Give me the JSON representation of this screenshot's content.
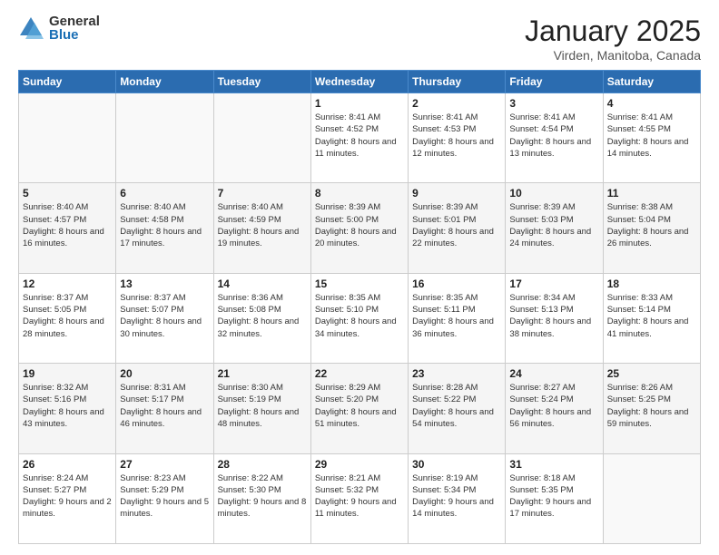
{
  "logo": {
    "general": "General",
    "blue": "Blue"
  },
  "header": {
    "title": "January 2025",
    "subtitle": "Virden, Manitoba, Canada"
  },
  "weekdays": [
    "Sunday",
    "Monday",
    "Tuesday",
    "Wednesday",
    "Thursday",
    "Friday",
    "Saturday"
  ],
  "weeks": [
    [
      {
        "day": "",
        "info": ""
      },
      {
        "day": "",
        "info": ""
      },
      {
        "day": "",
        "info": ""
      },
      {
        "day": "1",
        "info": "Sunrise: 8:41 AM\nSunset: 4:52 PM\nDaylight: 8 hours\nand 11 minutes."
      },
      {
        "day": "2",
        "info": "Sunrise: 8:41 AM\nSunset: 4:53 PM\nDaylight: 8 hours\nand 12 minutes."
      },
      {
        "day": "3",
        "info": "Sunrise: 8:41 AM\nSunset: 4:54 PM\nDaylight: 8 hours\nand 13 minutes."
      },
      {
        "day": "4",
        "info": "Sunrise: 8:41 AM\nSunset: 4:55 PM\nDaylight: 8 hours\nand 14 minutes."
      }
    ],
    [
      {
        "day": "5",
        "info": "Sunrise: 8:40 AM\nSunset: 4:57 PM\nDaylight: 8 hours\nand 16 minutes."
      },
      {
        "day": "6",
        "info": "Sunrise: 8:40 AM\nSunset: 4:58 PM\nDaylight: 8 hours\nand 17 minutes."
      },
      {
        "day": "7",
        "info": "Sunrise: 8:40 AM\nSunset: 4:59 PM\nDaylight: 8 hours\nand 19 minutes."
      },
      {
        "day": "8",
        "info": "Sunrise: 8:39 AM\nSunset: 5:00 PM\nDaylight: 8 hours\nand 20 minutes."
      },
      {
        "day": "9",
        "info": "Sunrise: 8:39 AM\nSunset: 5:01 PM\nDaylight: 8 hours\nand 22 minutes."
      },
      {
        "day": "10",
        "info": "Sunrise: 8:39 AM\nSunset: 5:03 PM\nDaylight: 8 hours\nand 24 minutes."
      },
      {
        "day": "11",
        "info": "Sunrise: 8:38 AM\nSunset: 5:04 PM\nDaylight: 8 hours\nand 26 minutes."
      }
    ],
    [
      {
        "day": "12",
        "info": "Sunrise: 8:37 AM\nSunset: 5:05 PM\nDaylight: 8 hours\nand 28 minutes."
      },
      {
        "day": "13",
        "info": "Sunrise: 8:37 AM\nSunset: 5:07 PM\nDaylight: 8 hours\nand 30 minutes."
      },
      {
        "day": "14",
        "info": "Sunrise: 8:36 AM\nSunset: 5:08 PM\nDaylight: 8 hours\nand 32 minutes."
      },
      {
        "day": "15",
        "info": "Sunrise: 8:35 AM\nSunset: 5:10 PM\nDaylight: 8 hours\nand 34 minutes."
      },
      {
        "day": "16",
        "info": "Sunrise: 8:35 AM\nSunset: 5:11 PM\nDaylight: 8 hours\nand 36 minutes."
      },
      {
        "day": "17",
        "info": "Sunrise: 8:34 AM\nSunset: 5:13 PM\nDaylight: 8 hours\nand 38 minutes."
      },
      {
        "day": "18",
        "info": "Sunrise: 8:33 AM\nSunset: 5:14 PM\nDaylight: 8 hours\nand 41 minutes."
      }
    ],
    [
      {
        "day": "19",
        "info": "Sunrise: 8:32 AM\nSunset: 5:16 PM\nDaylight: 8 hours\nand 43 minutes."
      },
      {
        "day": "20",
        "info": "Sunrise: 8:31 AM\nSunset: 5:17 PM\nDaylight: 8 hours\nand 46 minutes."
      },
      {
        "day": "21",
        "info": "Sunrise: 8:30 AM\nSunset: 5:19 PM\nDaylight: 8 hours\nand 48 minutes."
      },
      {
        "day": "22",
        "info": "Sunrise: 8:29 AM\nSunset: 5:20 PM\nDaylight: 8 hours\nand 51 minutes."
      },
      {
        "day": "23",
        "info": "Sunrise: 8:28 AM\nSunset: 5:22 PM\nDaylight: 8 hours\nand 54 minutes."
      },
      {
        "day": "24",
        "info": "Sunrise: 8:27 AM\nSunset: 5:24 PM\nDaylight: 8 hours\nand 56 minutes."
      },
      {
        "day": "25",
        "info": "Sunrise: 8:26 AM\nSunset: 5:25 PM\nDaylight: 8 hours\nand 59 minutes."
      }
    ],
    [
      {
        "day": "26",
        "info": "Sunrise: 8:24 AM\nSunset: 5:27 PM\nDaylight: 9 hours\nand 2 minutes."
      },
      {
        "day": "27",
        "info": "Sunrise: 8:23 AM\nSunset: 5:29 PM\nDaylight: 9 hours\nand 5 minutes."
      },
      {
        "day": "28",
        "info": "Sunrise: 8:22 AM\nSunset: 5:30 PM\nDaylight: 9 hours\nand 8 minutes."
      },
      {
        "day": "29",
        "info": "Sunrise: 8:21 AM\nSunset: 5:32 PM\nDaylight: 9 hours\nand 11 minutes."
      },
      {
        "day": "30",
        "info": "Sunrise: 8:19 AM\nSunset: 5:34 PM\nDaylight: 9 hours\nand 14 minutes."
      },
      {
        "day": "31",
        "info": "Sunrise: 8:18 AM\nSunset: 5:35 PM\nDaylight: 9 hours\nand 17 minutes."
      },
      {
        "day": "",
        "info": ""
      }
    ]
  ]
}
